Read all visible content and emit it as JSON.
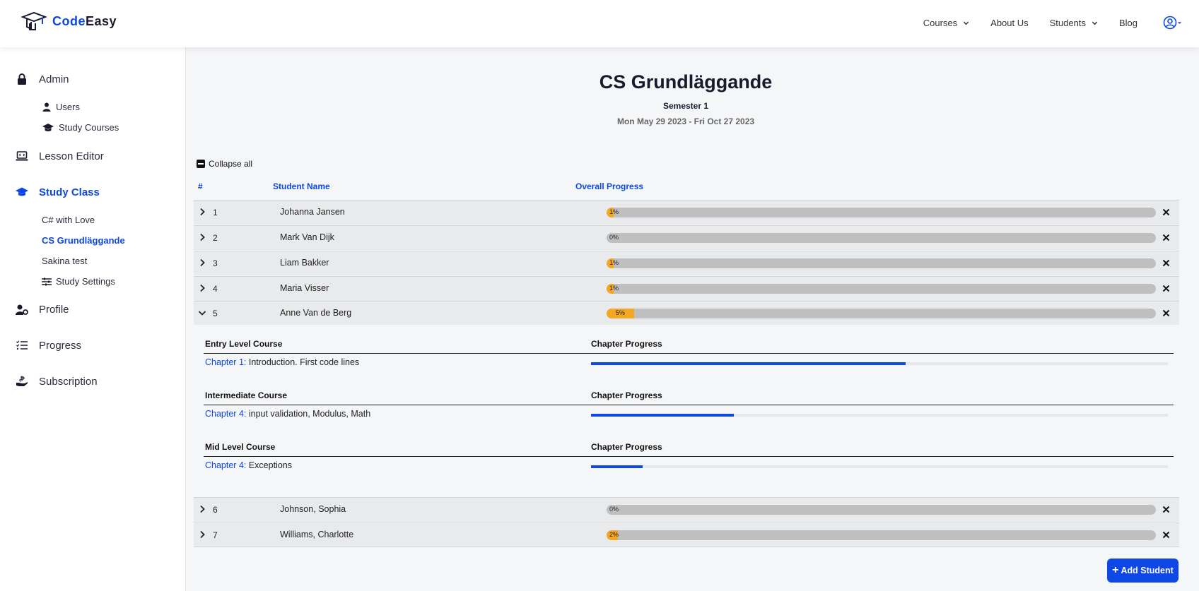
{
  "brand": {
    "part1": "Code",
    "part2": "Easy"
  },
  "nav": {
    "courses": "Courses",
    "about": "About Us",
    "students": "Students",
    "blog": "Blog"
  },
  "sidebar": {
    "admin": "Admin",
    "users": "Users",
    "study_courses": "Study Courses",
    "lesson_editor": "Lesson Editor",
    "study_class": "Study Class",
    "classes": [
      "C# with Love",
      "CS Grundläggande",
      "Sakina test"
    ],
    "study_settings": "Study Settings",
    "profile": "Profile",
    "progress": "Progress",
    "subscription": "Subscription"
  },
  "page": {
    "title": "CS Grundläggande",
    "semester": "Semester 1",
    "dates": "Mon May 29 2023 - Fri Oct 27 2023",
    "collapse_all": "Collapse all"
  },
  "table": {
    "headers": {
      "num": "#",
      "name": "Student Name",
      "progress": "Overall Progress"
    },
    "rows": [
      {
        "num": "1",
        "name": "Johanna Jansen",
        "progress_label": "1%",
        "progress": 1
      },
      {
        "num": "2",
        "name": "Mark Van Dijk",
        "progress_label": "0%",
        "progress": 0
      },
      {
        "num": "3",
        "name": "Liam Bakker",
        "progress_label": "1%",
        "progress": 1
      },
      {
        "num": "4",
        "name": "Maria Visser",
        "progress_label": "1%",
        "progress": 1
      },
      {
        "num": "5",
        "name": "Anne Van de Berg",
        "progress_label": "5%",
        "progress": 5
      },
      {
        "num": "6",
        "name": "Johnson, Sophia",
        "progress_label": "0%",
        "progress": 0
      },
      {
        "num": "7",
        "name": "Williams, Charlotte",
        "progress_label": "2%",
        "progress": 2
      }
    ]
  },
  "detail": {
    "courses": [
      {
        "course": "Entry Level Course",
        "progress_header": "Chapter Progress",
        "chapter_link": "Chapter 1:",
        "chapter_text": " Introduction. First code lines",
        "chapter_progress": 0.545
      },
      {
        "course": "Intermediate Course",
        "progress_header": "Chapter Progress",
        "chapter_link": "Chapter 4:",
        "chapter_text": " input validation, Modulus, Math",
        "chapter_progress": 0.248
      },
      {
        "course": "Mid Level Course",
        "progress_header": "Chapter Progress",
        "chapter_link": "Chapter 4:",
        "chapter_text": " Exceptions",
        "chapter_progress": 0.09
      }
    ]
  },
  "add_student": "Add Student",
  "colors": {
    "accent": "#0d47e6",
    "progress_fill": "#f5a623",
    "progress_track": "#bfbfbf"
  }
}
